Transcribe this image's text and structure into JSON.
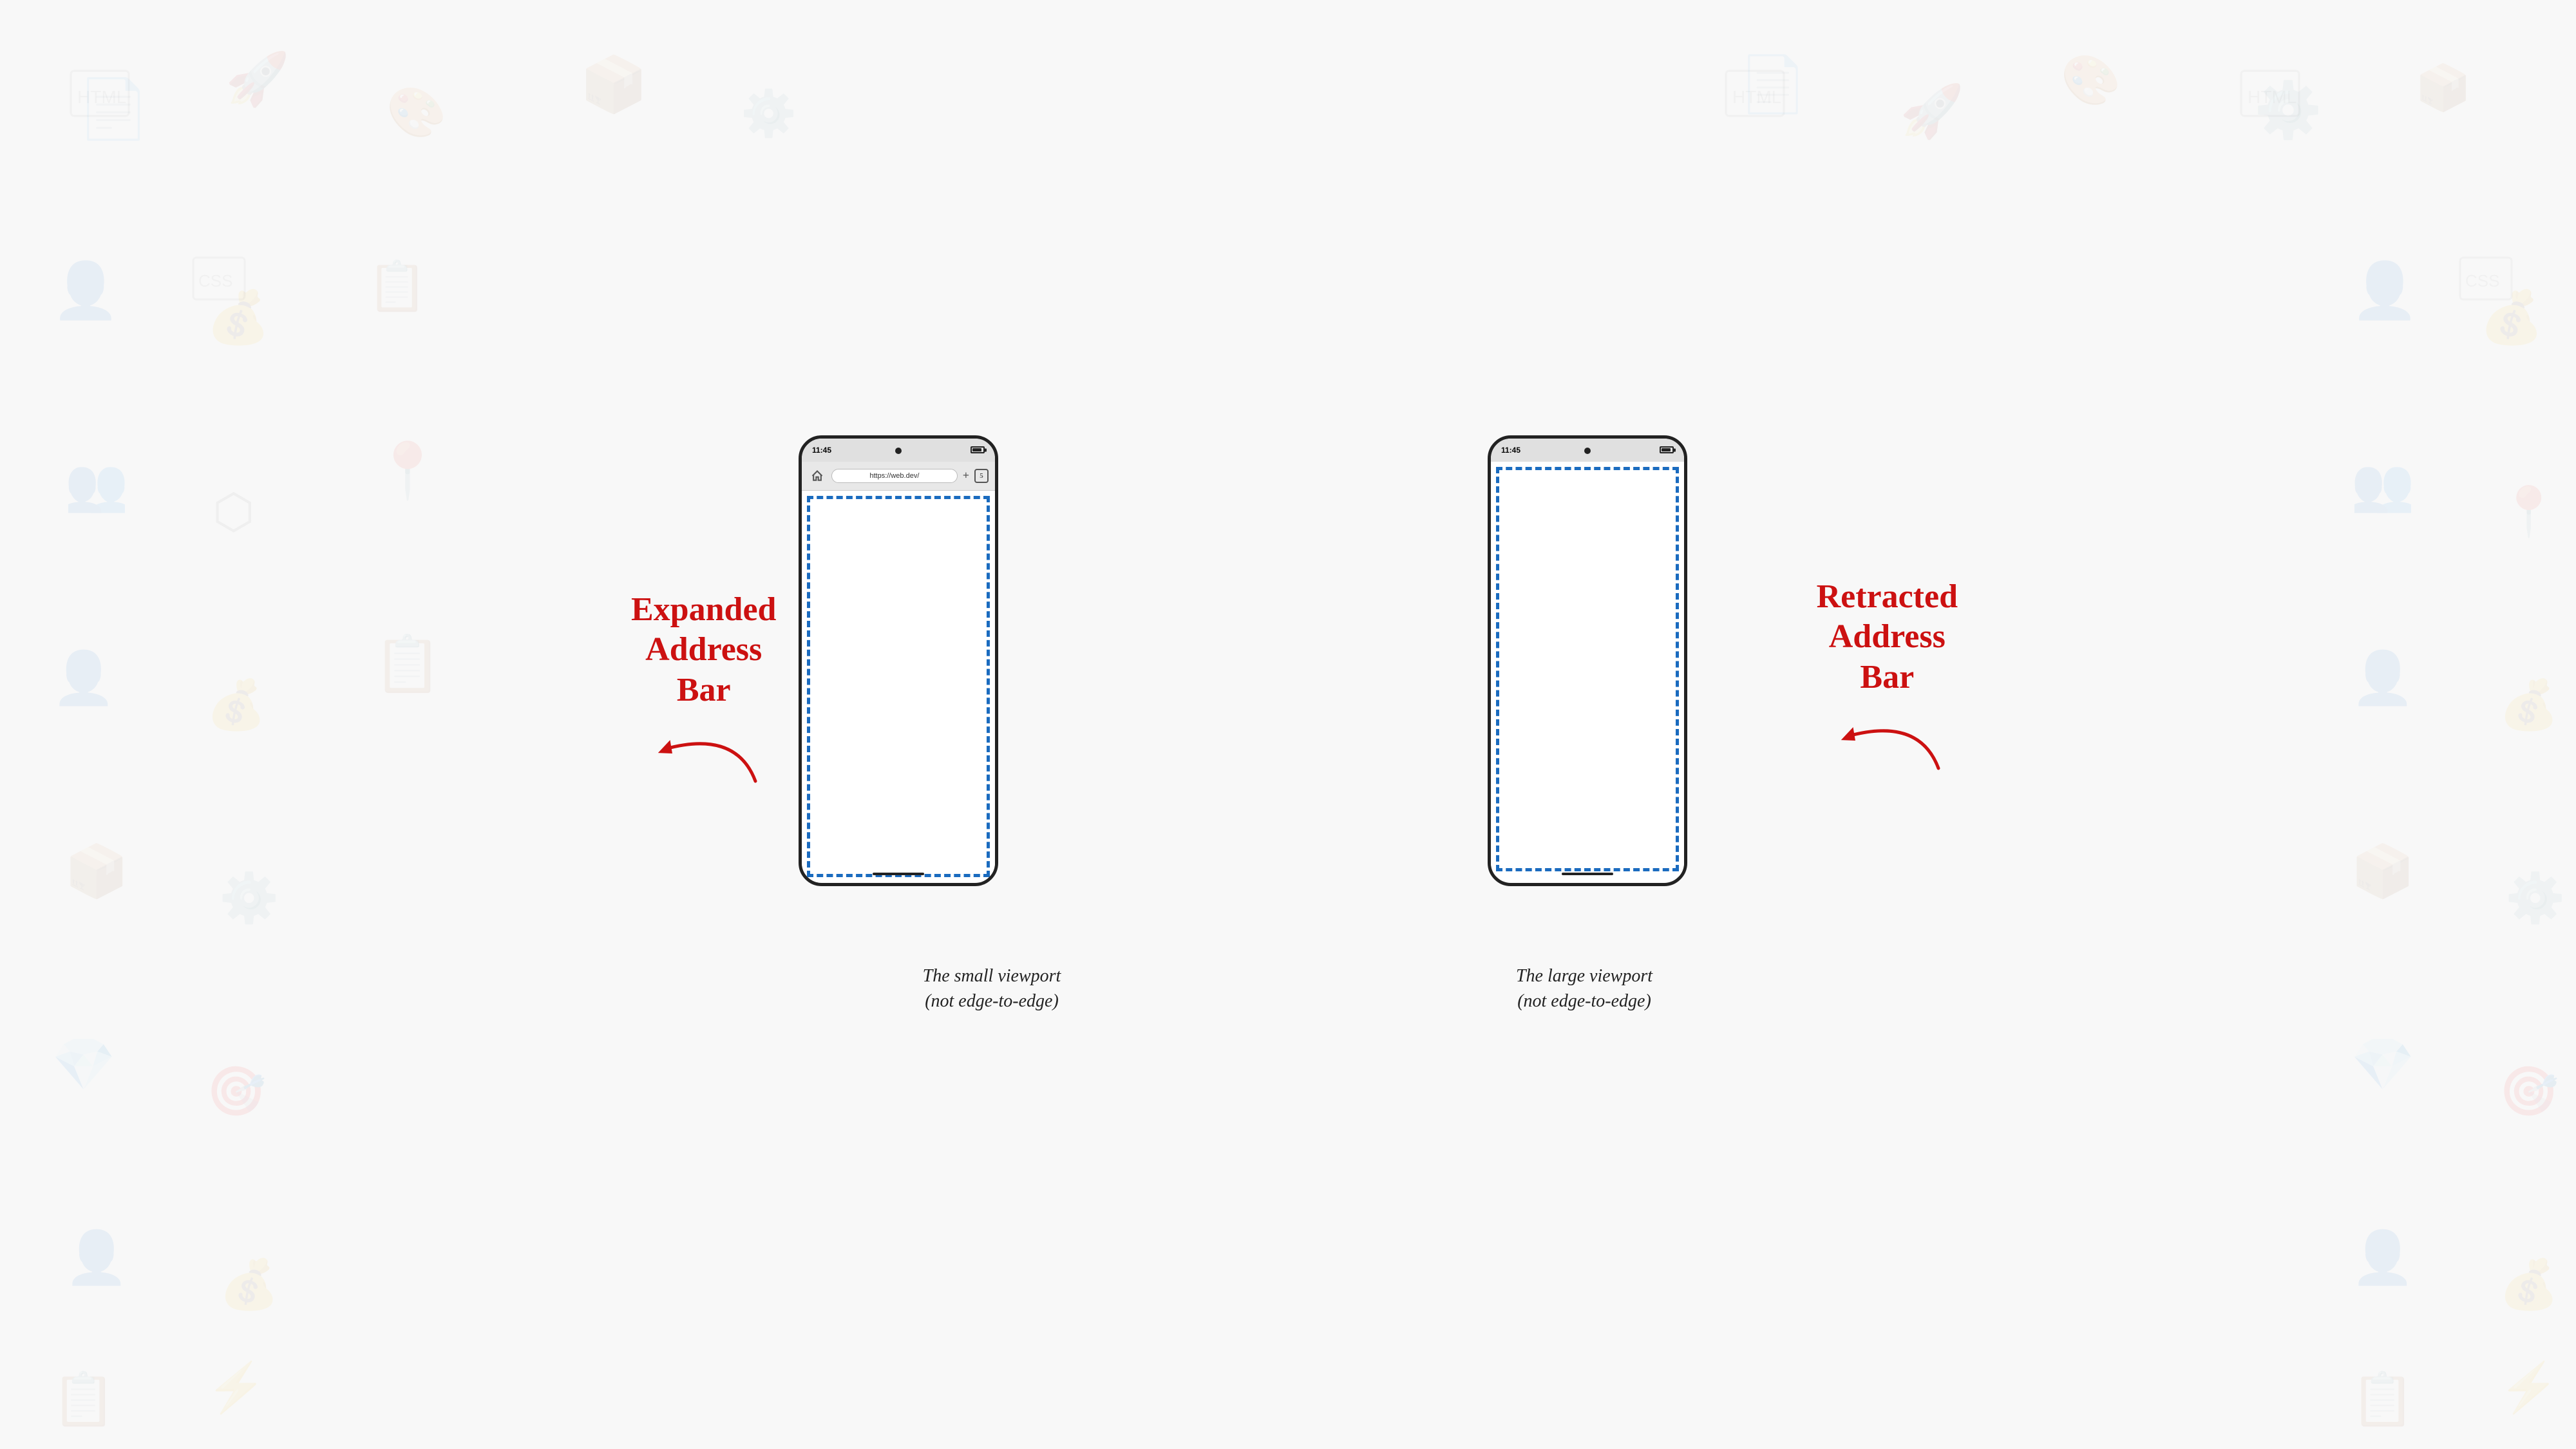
{
  "background": {
    "color": "#f8f8f8"
  },
  "expanded_phone": {
    "status_bar": {
      "time": "11:45",
      "battery_label": "battery"
    },
    "address_bar": {
      "url": "https://web.dev/",
      "tabs_count": "5"
    },
    "viewport_type": "small",
    "label": {
      "line1": "Expanded",
      "line2": "Address",
      "line3": "Bar"
    },
    "caption": {
      "line1": "The small viewport",
      "line2": "(not edge-to-edge)"
    }
  },
  "retracted_phone": {
    "status_bar": {
      "time": "11:45",
      "battery_label": "battery"
    },
    "viewport_type": "large",
    "label": {
      "line1": "Retracted",
      "line2": "Address",
      "line3": "Bar"
    },
    "caption": {
      "line1": "The large viewport",
      "line2": "(not edge-to-edge)"
    }
  },
  "arrows": {
    "expanded_direction": "right",
    "retracted_direction": "left"
  }
}
